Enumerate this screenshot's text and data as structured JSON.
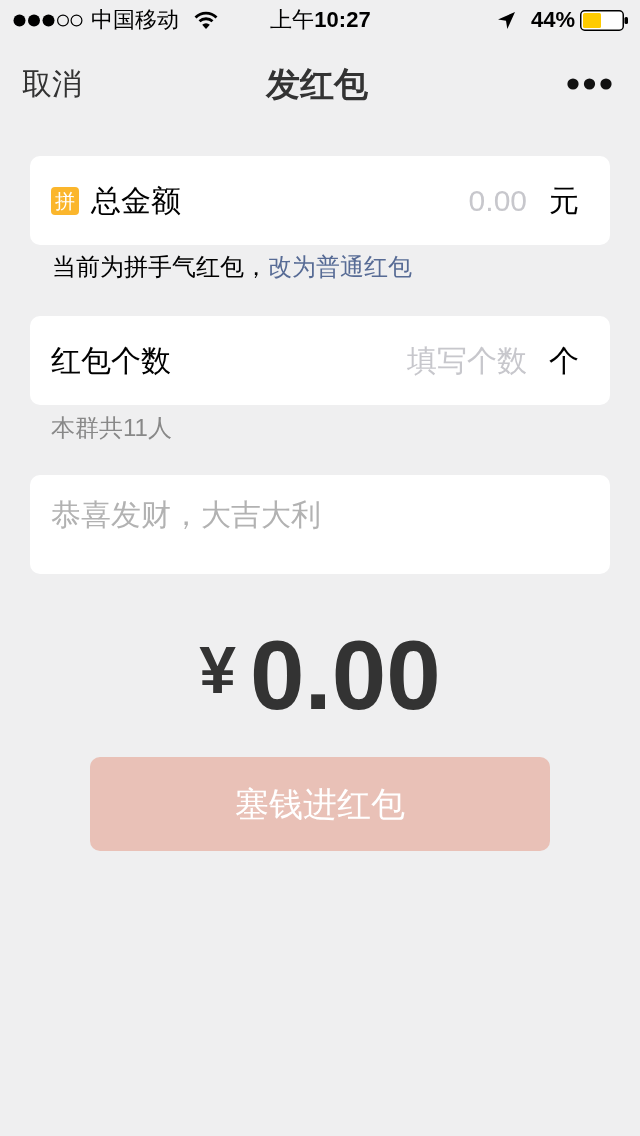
{
  "status_bar": {
    "carrier": "中国移动",
    "time": "上午**10:27**",
    "battery": "44%"
  },
  "nav": {
    "cancel": "取消",
    "title": "发红包"
  },
  "amount_row": {
    "badge": "拼",
    "label": "总金额",
    "placeholder": "0.00",
    "unit": "元"
  },
  "mode_hint": {
    "text": "当前为拼手气红包，",
    "link": "改为普通红包"
  },
  "count_row": {
    "label": "红包个数",
    "placeholder": "填写个数",
    "unit": "个"
  },
  "group_note": "本群共11人",
  "message": {
    "placeholder": "恭喜发财，大吉大利"
  },
  "total": {
    "currency": "¥",
    "amount": "0.00"
  },
  "submit": {
    "label": "塞钱进红包",
    "disabled": true
  }
}
